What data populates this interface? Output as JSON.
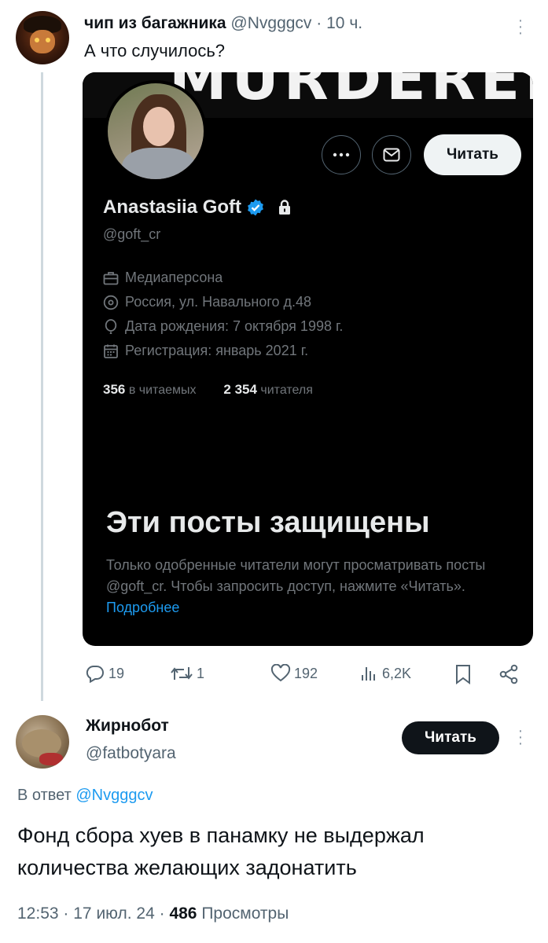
{
  "tweet": {
    "author_name": "чип из багажника",
    "author_handle": "@Nvgggcv",
    "separator": "·",
    "time": "10 ч.",
    "text": "А что случилось?",
    "stats": {
      "replies": "19",
      "retweets": "1",
      "likes": "192",
      "views": "6,2K"
    }
  },
  "embedded_profile": {
    "banner_text": "MURDERED",
    "follow_label": "Читать",
    "name": "Anastasiia Goft",
    "handle": "@goft_cr",
    "category": "Медиаперсона",
    "location": "Россия, ул. Навального д.48",
    "birthday": "Дата рождения: 7 октября 1998 г.",
    "joined": "Регистрация: январь 2021 г.",
    "following_count": "356",
    "following_label": "в читаемых",
    "followers_count": "2 354",
    "followers_label": "читателя",
    "protected_title": "Эти посты защищены",
    "protected_text": "Только одобренные читатели могут просматривать посты @goft_cr. Чтобы запросить доступ, нажмите «Читать».",
    "learn_more": "Подробнее"
  },
  "reply": {
    "author_name": "Жирнобот",
    "author_handle": "@fatbotyara",
    "follow_label": "Читать",
    "reply_to_label": "В ответ",
    "reply_to_handle": "@Nvgggcv",
    "text": "Фонд сбора хуев в панамку не выдержал количества желающих задонатить",
    "time": "12:53",
    "date": "17 июл. 24",
    "separator": "·",
    "views_count": "486",
    "views_label": "Просмотры"
  },
  "colors": {
    "link": "#1d9bf0",
    "text": "#0f1419",
    "secondary": "#536471",
    "verified": "#1d9bf0",
    "card_bg": "#000000"
  }
}
